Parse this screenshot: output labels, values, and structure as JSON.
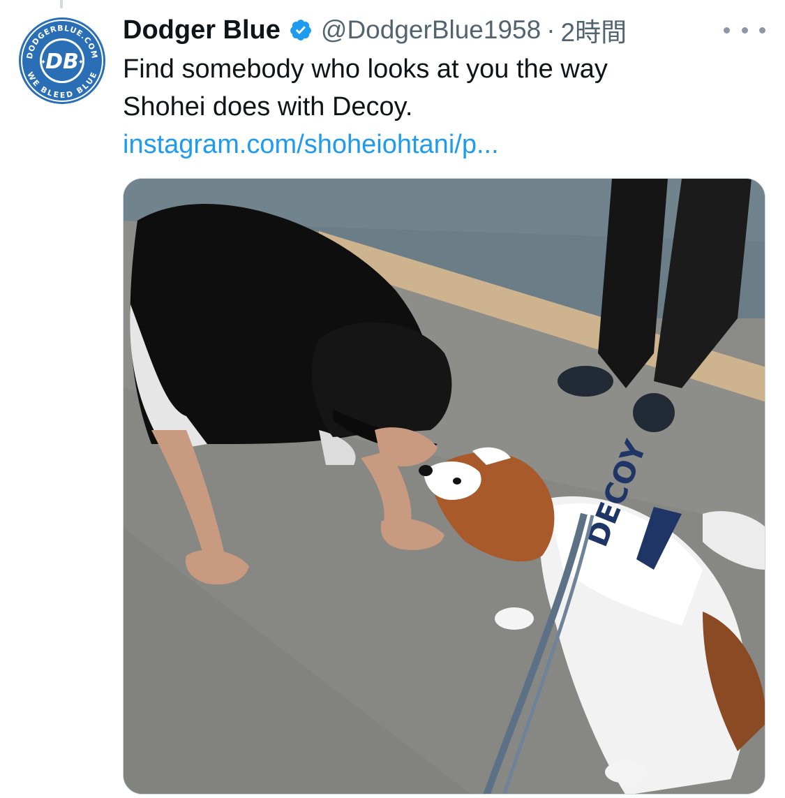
{
  "tweet": {
    "author": {
      "display_name": "Dodger Blue",
      "handle": "@DodgerBlue1958",
      "verified": true,
      "avatar": {
        "icon": "dodger-blue-logo-icon",
        "logo_text_top": "DODGERBLUE.COM",
        "logo_text_center": "DB",
        "logo_text_bottom": "WE BLEED BLUE"
      }
    },
    "separator": "·",
    "timestamp": "2時間",
    "text_lines": [
      "Find somebody who looks at you the way",
      "Shohei does with Decoy."
    ],
    "link_text": "instagram.com/shoheiohtani/p...",
    "more_icon": "more-horizontal-icon",
    "media": {
      "type": "photo",
      "jersey_text": "DECOY"
    }
  },
  "colors": {
    "link": "#1d9bf0",
    "verified_badge": "#1d9bf0",
    "secondary_text": "#536471",
    "primary_text": "#0f1419",
    "avatar_blue": "#2a6fb6"
  }
}
